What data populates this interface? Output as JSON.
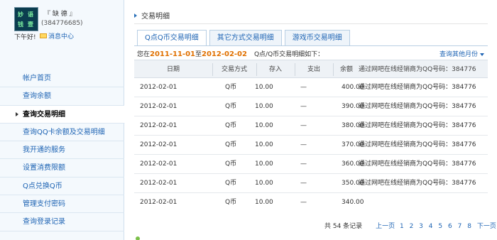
{
  "profile": {
    "avatar_text": [
      "妙",
      "语",
      "钱",
      "壹"
    ],
    "username": "『 缺 德 』",
    "qq": "(384776685)",
    "greeting": "下午好!",
    "messages_label": "消息中心"
  },
  "nav": {
    "items": [
      {
        "label": "帐户首页"
      },
      {
        "label": "查询余额"
      },
      {
        "label": "查询交易明细"
      },
      {
        "label": "查询QQ卡余额及交易明细"
      },
      {
        "label": "我开通的服务"
      },
      {
        "label": "设置消费限额"
      },
      {
        "label": "Q点兑换Q币"
      },
      {
        "label": "管理支付密码"
      },
      {
        "label": "查询登录记录"
      }
    ],
    "active_index": 2
  },
  "main": {
    "title": "交易明细",
    "tabs": [
      {
        "label": "Q点Q币交易明细"
      },
      {
        "label": "其它方式交易明细"
      },
      {
        "label": "游戏币交易明细"
      }
    ],
    "range": {
      "prefix": "您在",
      "start": "2011-11-01",
      "mid": "至",
      "end": "2012-02-02",
      "query_label": "Q点/Q币交易明细如下："
    },
    "more_months": "查询其他月份"
  },
  "table": {
    "headers": [
      "日期",
      "交易方式",
      "存入",
      "支出",
      "余额",
      "通过网吧在线经销商为QQ号码：384776"
    ],
    "rows": [
      {
        "date": "2012-02-01",
        "method": "Q币",
        "in": "10.00",
        "out": "—",
        "balance": "400.00",
        "note": "通过网吧在线经销商为QQ号码：384776"
      },
      {
        "date": "2012-02-01",
        "method": "Q币",
        "in": "10.00",
        "out": "—",
        "balance": "390.00",
        "note": "通过网吧在线经销商为QQ号码：384776"
      },
      {
        "date": "2012-02-01",
        "method": "Q币",
        "in": "10.00",
        "out": "—",
        "balance": "380.00",
        "note": "通过网吧在线经销商为QQ号码：384776"
      },
      {
        "date": "2012-02-01",
        "method": "Q币",
        "in": "10.00",
        "out": "—",
        "balance": "370.00",
        "note": "通过网吧在线经销商为QQ号码：384776"
      },
      {
        "date": "2012-02-01",
        "method": "Q币",
        "in": "10.00",
        "out": "—",
        "balance": "360.00",
        "note": "通过网吧在线经销商为QQ号码：384776"
      },
      {
        "date": "2012-02-01",
        "method": "Q币",
        "in": "10.00",
        "out": "—",
        "balance": "350.00",
        "note": "通过网吧在线经销商为QQ号码：384776"
      },
      {
        "date": "2012-02-01",
        "method": "Q币",
        "in": "10.00",
        "out": "—",
        "balance": "340.00",
        "note": ""
      }
    ]
  },
  "pager": {
    "total": "共 54 条记录",
    "prev": "上一页",
    "pages": [
      "1",
      "2",
      "3",
      "4",
      "5",
      "6",
      "7",
      "8"
    ],
    "next": "下一页"
  }
}
